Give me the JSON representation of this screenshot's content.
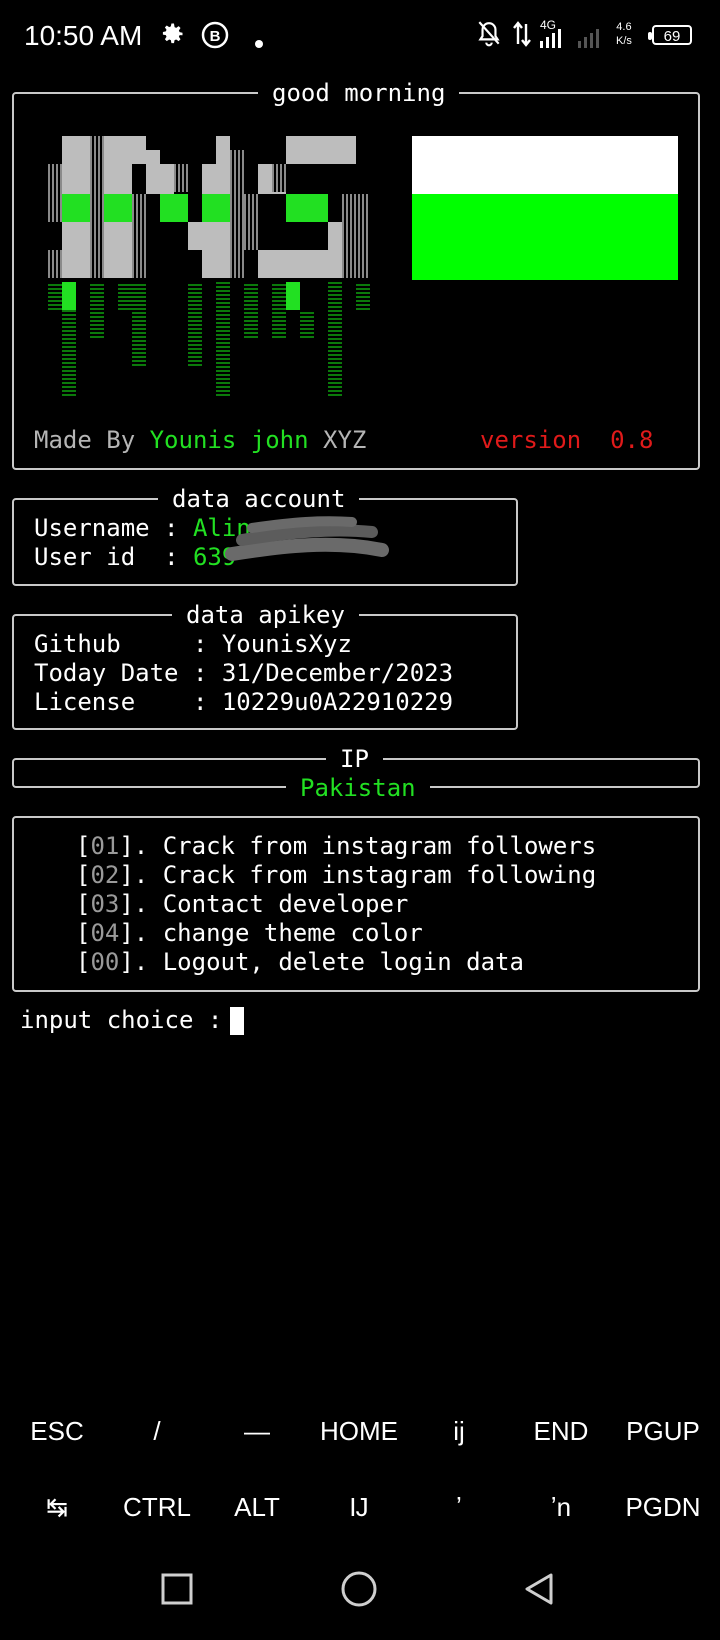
{
  "status_bar": {
    "time": "10:50 AM",
    "icons": [
      "gear-icon",
      "b-circle-icon",
      "dot-icon",
      "bell-off-icon",
      "data-arrows-icon",
      "signal-4g-icon",
      "signal-icon"
    ],
    "network": "4G",
    "speed_value": "4.6",
    "speed_unit": "K/s",
    "battery": "69"
  },
  "banner": {
    "greeting": "good morning",
    "made_by_label": "Made By",
    "author_name": "Younis john",
    "author_suffix": "XYZ",
    "version_label": "version",
    "version_value": "0.8",
    "flag_colors": [
      "#ffffff",
      "#00ff00"
    ]
  },
  "account": {
    "title": "data account",
    "username_label": "Username",
    "username_value": "Alina",
    "userid_label": "User id",
    "userid_value": "639",
    "separator": ":"
  },
  "apikey": {
    "title": "data apikey",
    "rows": [
      {
        "label": "Github",
        "value": "YounisXyz"
      },
      {
        "label": "Today Date",
        "value": "31/December/2023"
      },
      {
        "label": "License",
        "value": "10229u0A22910229"
      }
    ]
  },
  "ip": {
    "title": "IP",
    "country": "Pakistan"
  },
  "menu": {
    "items": [
      {
        "num": "01",
        "text": "Crack from instagram followers"
      },
      {
        "num": "02",
        "text": "Crack from instagram following"
      },
      {
        "num": "03",
        "text": "Contact developer"
      },
      {
        "num": "04",
        "text": "change theme color"
      },
      {
        "num": "00",
        "text": "Logout, delete login data"
      }
    ]
  },
  "prompt": {
    "label": "input choice :"
  },
  "extra_keys": {
    "row1": [
      "ESC",
      "/",
      "—",
      "HOME",
      "ij",
      "END",
      "PGUP"
    ],
    "row2": [
      "↹",
      "CTRL",
      "ALT",
      "Ĳ",
      "ʼ",
      "ʼn",
      "PGDN"
    ]
  },
  "colors": {
    "accent_green": "#22e022",
    "version_red": "#e01a1a",
    "border": "#c9c9c9"
  }
}
